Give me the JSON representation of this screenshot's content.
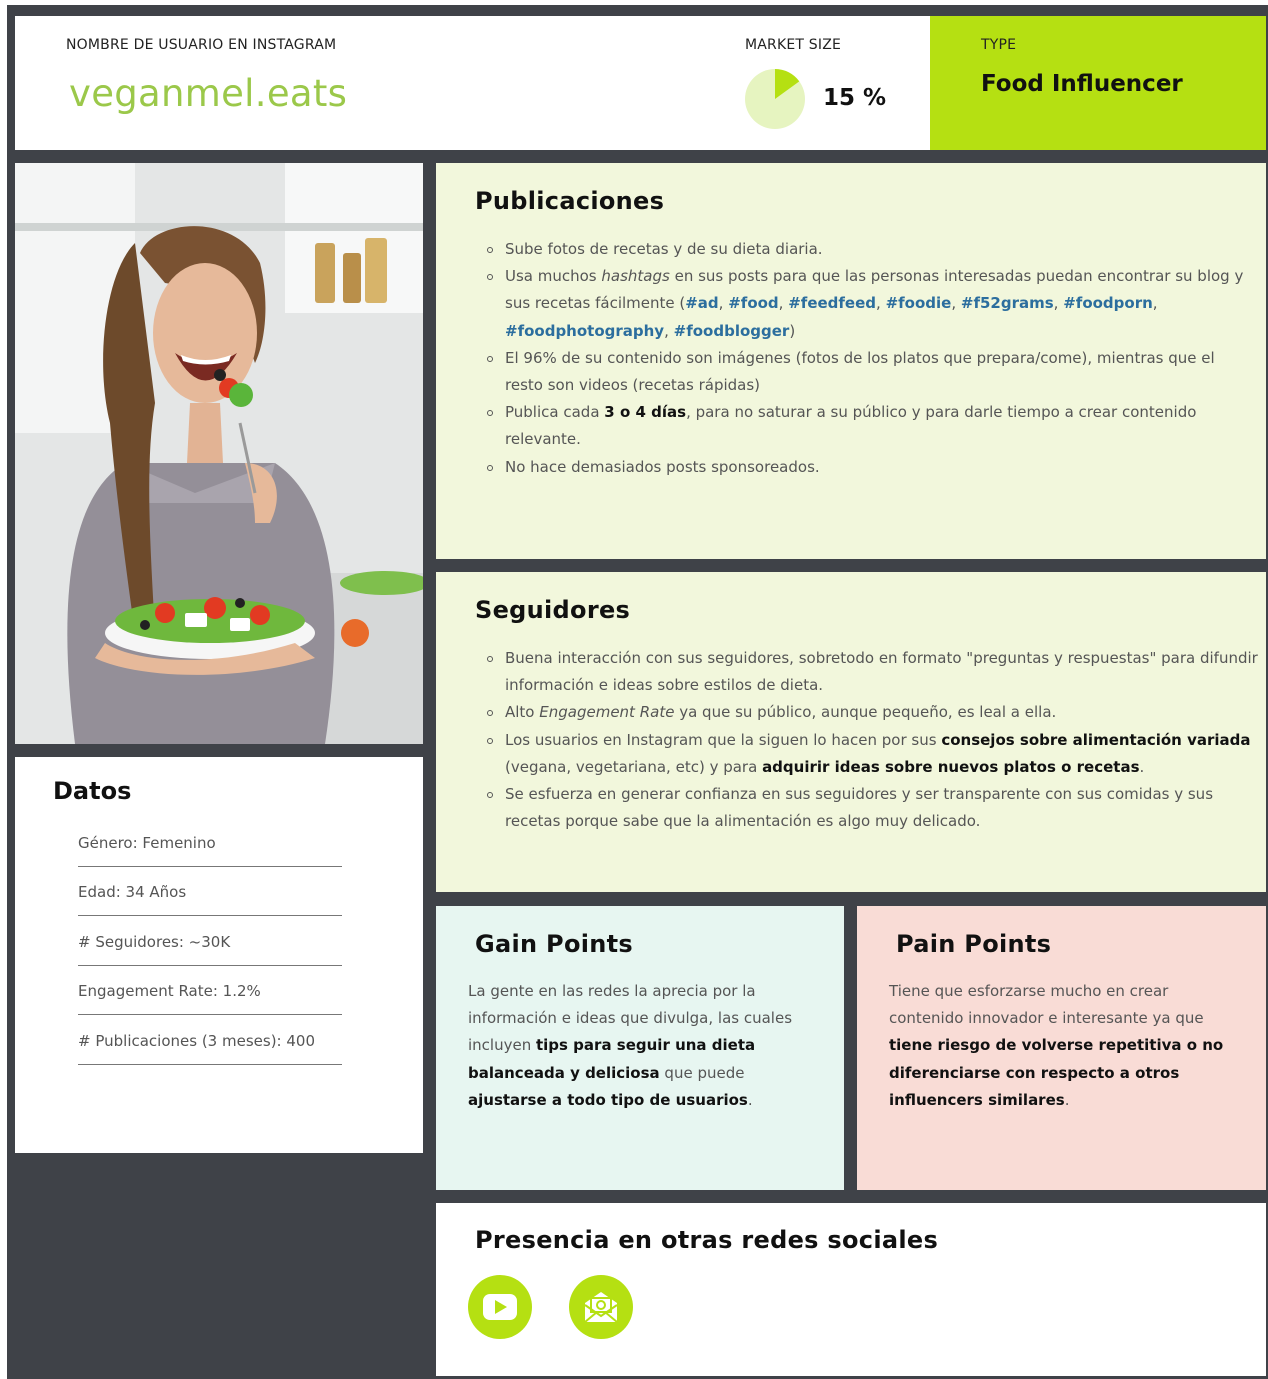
{
  "header": {
    "username_label": "NOMBRE DE USUARIO EN INSTAGRAM",
    "username": "veganmel.eats",
    "market_label": "MARKET SIZE",
    "market_value": "15 %",
    "market_fraction": 0.15,
    "type_label": "TYPE",
    "type_value": "Food Influencer"
  },
  "colors": {
    "accent": "#b5e012",
    "username": "#9bc84a",
    "hashtag": "#2c6e9e",
    "frame": "#3f4248"
  },
  "datos": {
    "title": "Datos",
    "rows": [
      "Género: Femenino",
      "Edad: 34 Años",
      "# Seguidores: ~30K",
      "Engagement Rate: 1.2%",
      "# Publicaciones (3 meses): 400"
    ]
  },
  "publicaciones": {
    "title": "Publicaciones",
    "b1": "Sube fotos de recetas y de su dieta diaria.",
    "b2_a": "Usa muchos ",
    "b2_em": "hashtags",
    "b2_b": " en sus posts para que las personas interesadas puedan encontrar su blog y sus recetas fácilmente (",
    "tags": [
      "#ad",
      "#food",
      "#feedfeed",
      "#foodie",
      "#f52grams",
      "#foodporn",
      "#foodphotography",
      "#foodblogger"
    ],
    "sep": ", ",
    "b2_end": ")",
    "b3": "El 96% de su contenido son imágenes (fotos de los platos que prepara/come), mientras que el resto son videos (recetas rápidas)",
    "b4_a": "Publica cada ",
    "b4_bold": "3 o 4 días",
    "b4_b": ", para no saturar a su público y para darle tiempo a crear contenido relevante.",
    "b5": "No hace demasiados posts sponsoreados."
  },
  "seguidores": {
    "title": "Seguidores",
    "b1": "Buena interacción con sus seguidores, sobretodo en formato \"preguntas y respuestas\" para difundir información e ideas sobre estilos de dieta.",
    "b2_a": "Alto ",
    "b2_em": "Engagement Rate",
    "b2_b": " ya que su público, aunque pequeño, es leal a ella.",
    "b3_a": "Los usuarios en Instagram que la siguen lo hacen por sus ",
    "b3_bold1": "consejos sobre alimentación variada",
    "b3_b": " (vegana, vegetariana, etc) y para ",
    "b3_bold2": "adquirir ideas sobre nuevos platos o recetas",
    "b3_c": ".",
    "b4": "Se esfuerza en generar confianza en sus seguidores y ser transparente con sus comidas y sus recetas porque sabe que la alimentación es algo muy delicado."
  },
  "gain": {
    "title": "Gain Points",
    "a": "La gente en las redes la aprecia por la información e ideas que divulga, las cuales incluyen ",
    "bold1": "tips para seguir una dieta balanceada y deliciosa",
    "b": " que puede ",
    "bold2": "ajustarse a todo tipo de usuarios",
    "c": "."
  },
  "pain": {
    "title": "Pain Points",
    "a": "Tiene que esforzarse mucho en crear contenido innovador e interesante ya que ",
    "bold1": "tiene riesgo de volverse repetitiva o no diferenciarse con respecto a otros influencers similares",
    "b": "."
  },
  "redes": {
    "title": "Presencia en otras redes sociales",
    "icons": [
      "youtube-icon",
      "email-newsletter-icon"
    ]
  }
}
